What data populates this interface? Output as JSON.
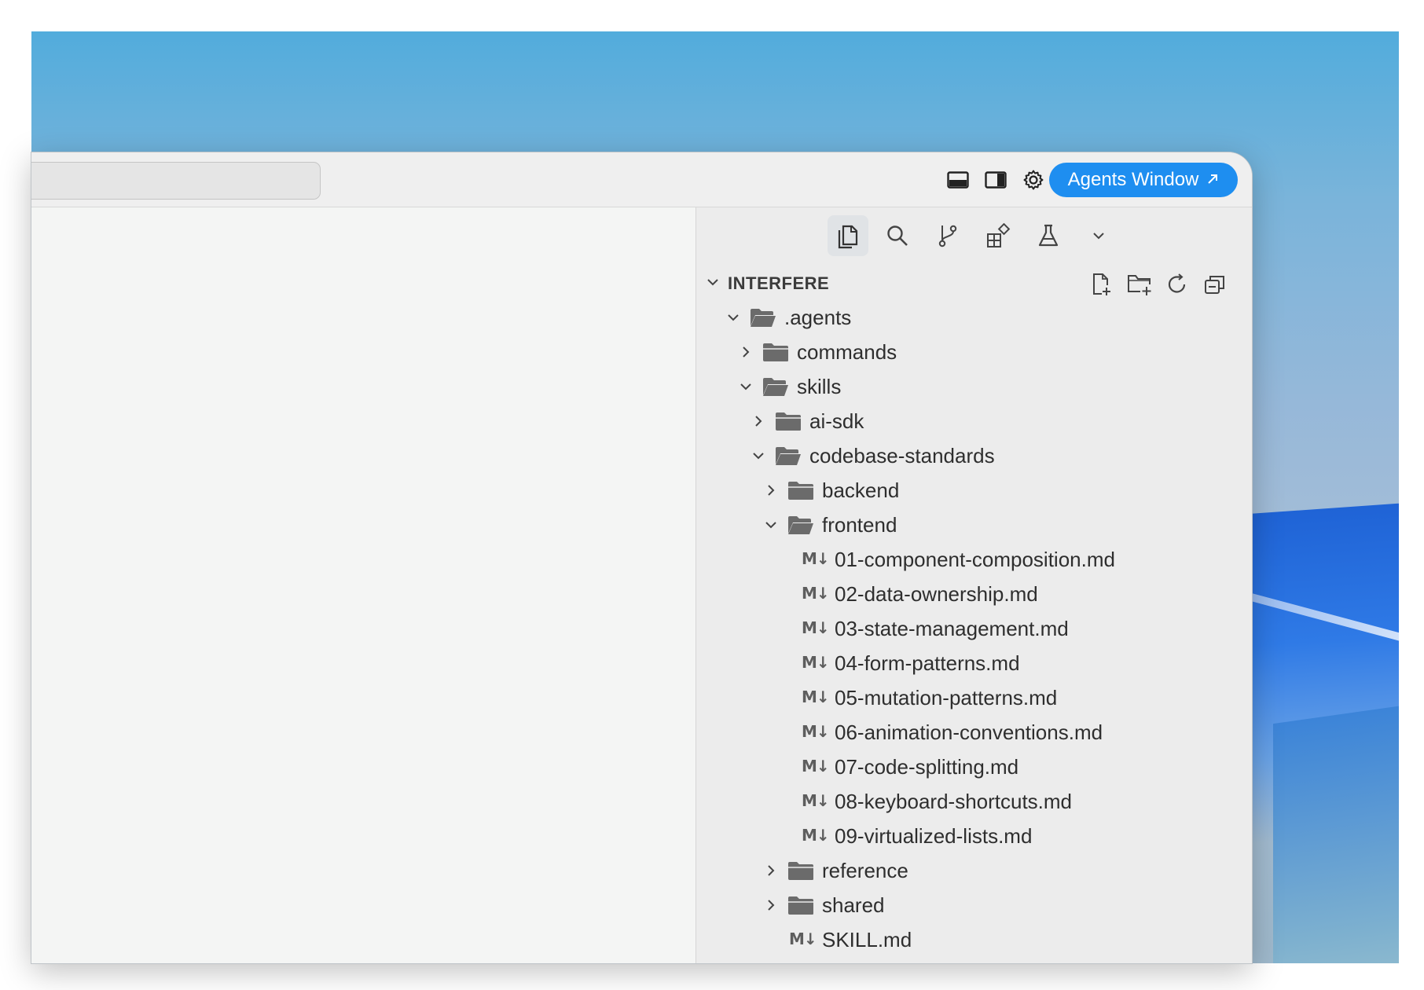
{
  "toolbar": {
    "agents_button_label": "Agents Window",
    "icons": [
      "toggle-panel-icon",
      "toggle-secondary-sidebar-icon",
      "settings-gear-icon"
    ]
  },
  "activity_bar": {
    "icons": [
      "explorer-icon",
      "search-icon",
      "source-control-icon",
      "extensions-icon",
      "testing-icon",
      "more-chevron-icon"
    ],
    "active": "explorer-icon"
  },
  "explorer": {
    "title": "INTERFERE",
    "header_actions": [
      "new-file-icon",
      "new-folder-icon",
      "refresh-icon",
      "collapse-all-icon"
    ],
    "items": [
      {
        "label": ".agents",
        "kind": "folder",
        "depth": 0,
        "expanded": true
      },
      {
        "label": "commands",
        "kind": "folder",
        "depth": 1,
        "expanded": false
      },
      {
        "label": "skills",
        "kind": "folder",
        "depth": 1,
        "expanded": true
      },
      {
        "label": "ai-sdk",
        "kind": "folder",
        "depth": 2,
        "expanded": false
      },
      {
        "label": "codebase-standards",
        "kind": "folder",
        "depth": 2,
        "expanded": true
      },
      {
        "label": "backend",
        "kind": "folder",
        "depth": 3,
        "expanded": false
      },
      {
        "label": "frontend",
        "kind": "folder",
        "depth": 3,
        "expanded": true
      },
      {
        "label": "01-component-composition.md",
        "kind": "markdown",
        "depth": 4
      },
      {
        "label": "02-data-ownership.md",
        "kind": "markdown",
        "depth": 4
      },
      {
        "label": "03-state-management.md",
        "kind": "markdown",
        "depth": 4
      },
      {
        "label": "04-form-patterns.md",
        "kind": "markdown",
        "depth": 4
      },
      {
        "label": "05-mutation-patterns.md",
        "kind": "markdown",
        "depth": 4
      },
      {
        "label": "06-animation-conventions.md",
        "kind": "markdown",
        "depth": 4
      },
      {
        "label": "07-code-splitting.md",
        "kind": "markdown",
        "depth": 4
      },
      {
        "label": "08-keyboard-shortcuts.md",
        "kind": "markdown",
        "depth": 4
      },
      {
        "label": "09-virtualized-lists.md",
        "kind": "markdown",
        "depth": 4
      },
      {
        "label": "reference",
        "kind": "folder",
        "depth": 3,
        "expanded": false
      },
      {
        "label": "shared",
        "kind": "folder",
        "depth": 3,
        "expanded": false
      },
      {
        "label": "SKILL.md",
        "kind": "markdown",
        "depth": 3
      }
    ]
  },
  "colors": {
    "accent": "#1e8ef0",
    "folder": "#6b6b6b",
    "text": "#2e2e2e"
  }
}
